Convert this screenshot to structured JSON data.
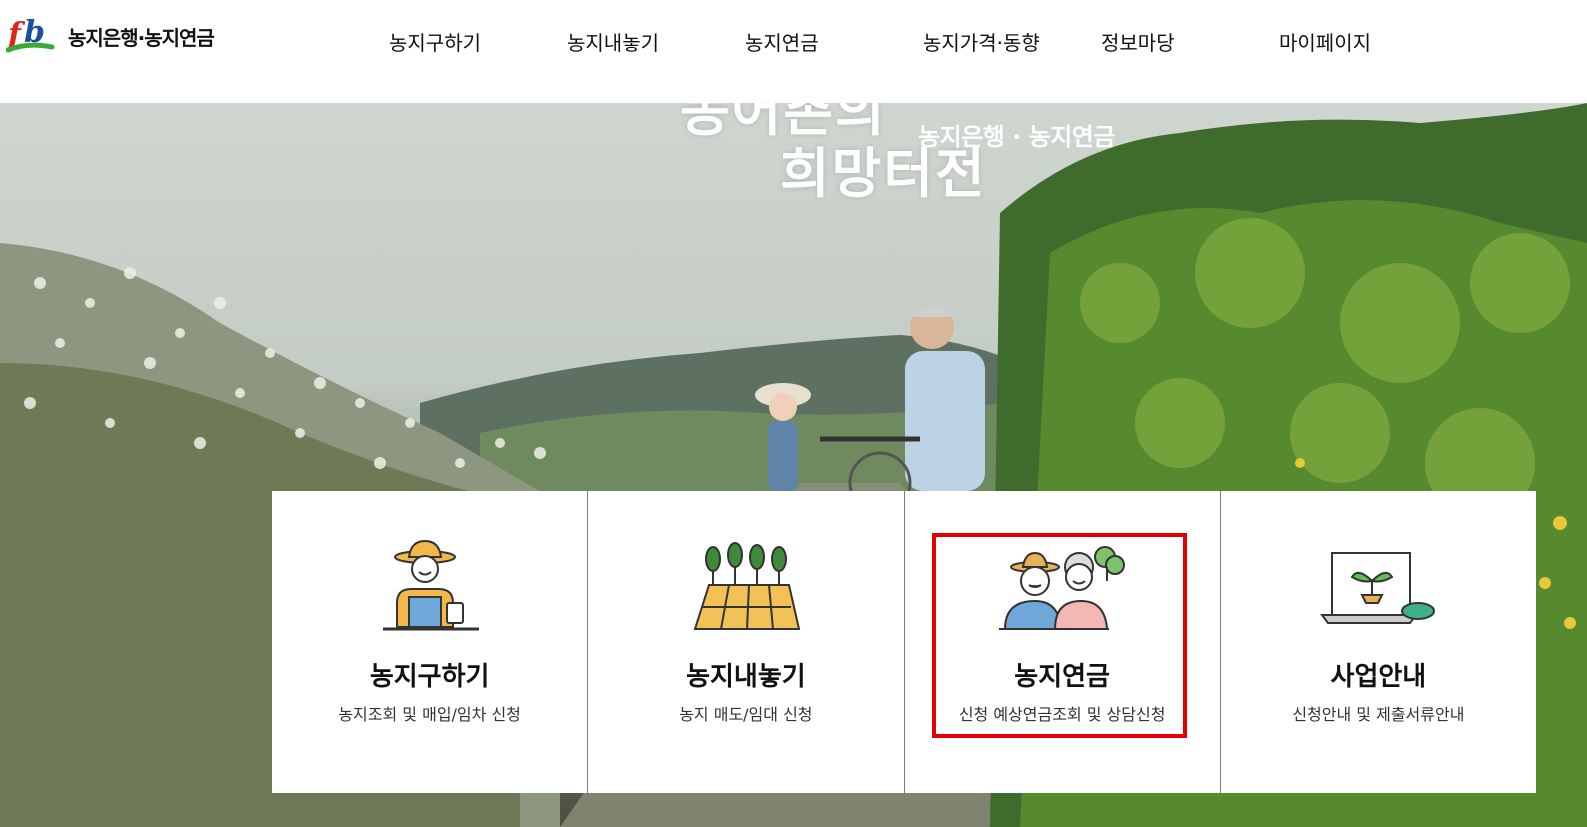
{
  "header": {
    "logo_text": "농지은행·농지연금",
    "nav": [
      {
        "label": "농지구하기"
      },
      {
        "label": "농지내놓기"
      },
      {
        "label": "농지연금"
      },
      {
        "label": "농지가격·동향"
      },
      {
        "label": "정보마당"
      },
      {
        "label": "마이페이지"
      }
    ]
  },
  "hero": {
    "title_line1": "농어촌의",
    "title_line2": "희망터전",
    "subtitle": "농지은행 · 농지연금"
  },
  "cards": [
    {
      "title": "농지구하기",
      "desc": "농지조회 및 매입/임차 신청",
      "icon": "farmer-icon"
    },
    {
      "title": "농지내놓기",
      "desc": "농지 매도/임대 신청",
      "icon": "farmland-icon"
    },
    {
      "title": "농지연금",
      "desc": "신청 예상연금조회 및 상담신청",
      "icon": "elderly-couple-icon",
      "highlighted": true
    },
    {
      "title": "사업안내",
      "desc": "신청안내 및 제출서류안내",
      "icon": "sprout-laptop-icon"
    }
  ],
  "colors": {
    "highlight": "#e60000",
    "logo_red": "#e2231a",
    "logo_blue": "#1b4ea0",
    "logo_green": "#3aa935"
  }
}
